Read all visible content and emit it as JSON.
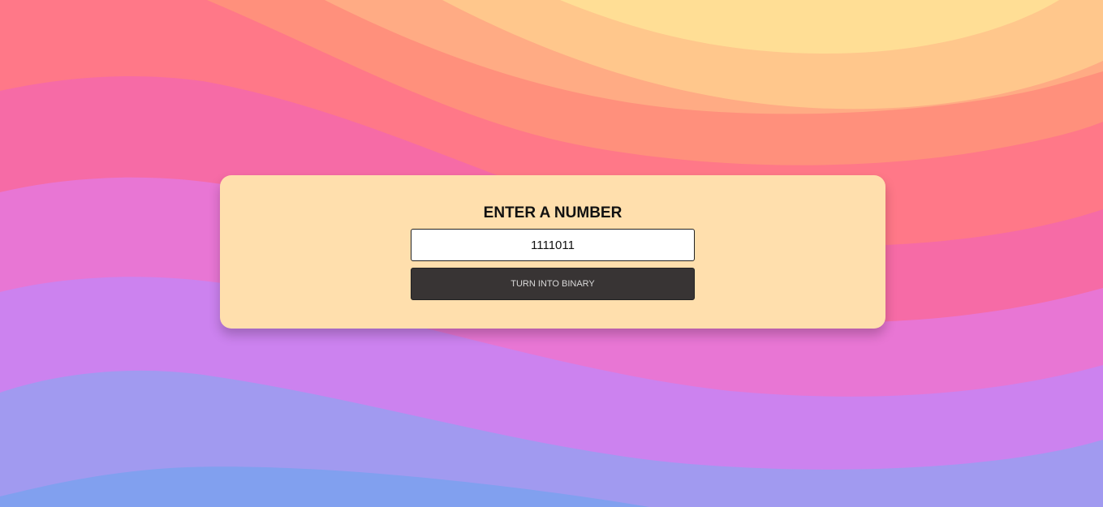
{
  "card": {
    "title": "ENTER A NUMBER",
    "input_value": "1111011",
    "button_label": "TURN INTO BINARY"
  },
  "colors": {
    "card_background": "#ffdfad",
    "button_background": "#383434",
    "wave_colors": [
      "#81a0ef",
      "#a19af0",
      "#cc82ef",
      "#e876d4",
      "#f66ba6",
      "#ff7888",
      "#ff907c",
      "#ffab84",
      "#ffc78c",
      "#ffde95"
    ]
  }
}
